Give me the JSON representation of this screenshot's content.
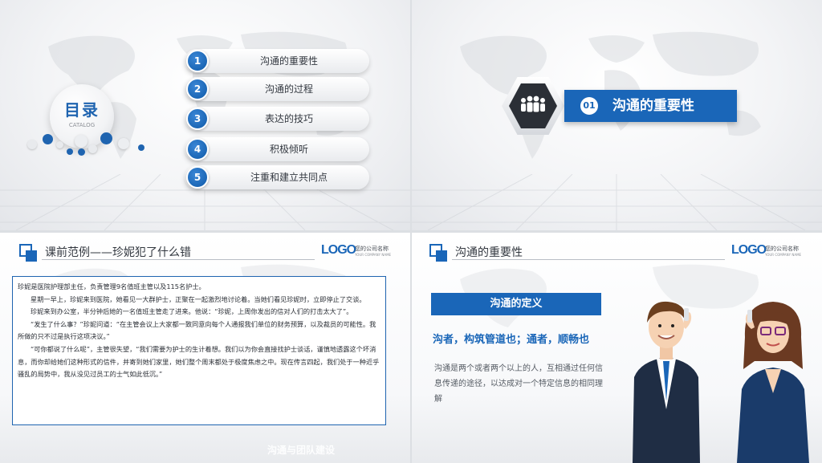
{
  "slide1": {
    "toc_title": "目录",
    "toc_subtitle": "CATALOG",
    "items": [
      {
        "num": "1",
        "label": "沟通的重要性"
      },
      {
        "num": "2",
        "label": "沟通的过程"
      },
      {
        "num": "3",
        "label": "表达的技巧"
      },
      {
        "num": "4",
        "label": "积极倾听"
      },
      {
        "num": "5",
        "label": "注重和建立共同点"
      }
    ]
  },
  "slide2": {
    "section_num": "01",
    "section_title": "沟通的重要性",
    "icon": "people-group-icon"
  },
  "slide3": {
    "title": "课前范例——珍妮犯了什么错",
    "logo_text": "LOGO",
    "company_name": "您的公司名称",
    "company_sub": "YOUR COMPANY NAME",
    "paragraphs": [
      "珍妮是医院护理部主任，负责管理9名值班主管以及115名护士。",
      "星期一早上，珍妮来到医院，她看见一大群护士，正聚在一起激烈地讨论着。当她们看见珍妮时，立即停止了交谈。",
      "珍妮来到办公室，半分钟后她的一名值班主管走了进来。他说：“珍妮，上周你发出的信对人们的打击太大了”。",
      "“发生了什么事？”珍妮问道：“在主管会议上大家都一致同意向每个人通报我们单位的财务预算，以及裁员的可能性。我所做的只不过是执行这项决议。”",
      "“可你都说了什么呢”，主管很失望，“我们需要为护士的生计着想。我们以为你会直接找护士谈话，谨慎地透露这个坏消息，而你却给她们这种形式的信件，并寄到她们家里，她们整个周末都处于极度焦虑之中。现在传言四起，我们处于一种近乎骚乱的局势中，我从没见过员工的士气如此低沉。”"
    ],
    "watermark": "沟通与团队建设"
  },
  "slide4": {
    "title": "沟通的重要性",
    "logo_text": "LOGO",
    "company_name": "您的公司名称",
    "company_sub": "YOUR COMPANY NAME",
    "definition_label": "沟通的定义",
    "slogan": "沟者，构筑管道也；通者，顺畅也",
    "definition_text": "沟通是两个或者两个以上的人，互相通过任何信息传递的途径，以达成对一个特定信息的相同理解"
  },
  "colors": {
    "accent": "#1a66b8",
    "dark": "#2b2f36",
    "text": "#333840"
  }
}
